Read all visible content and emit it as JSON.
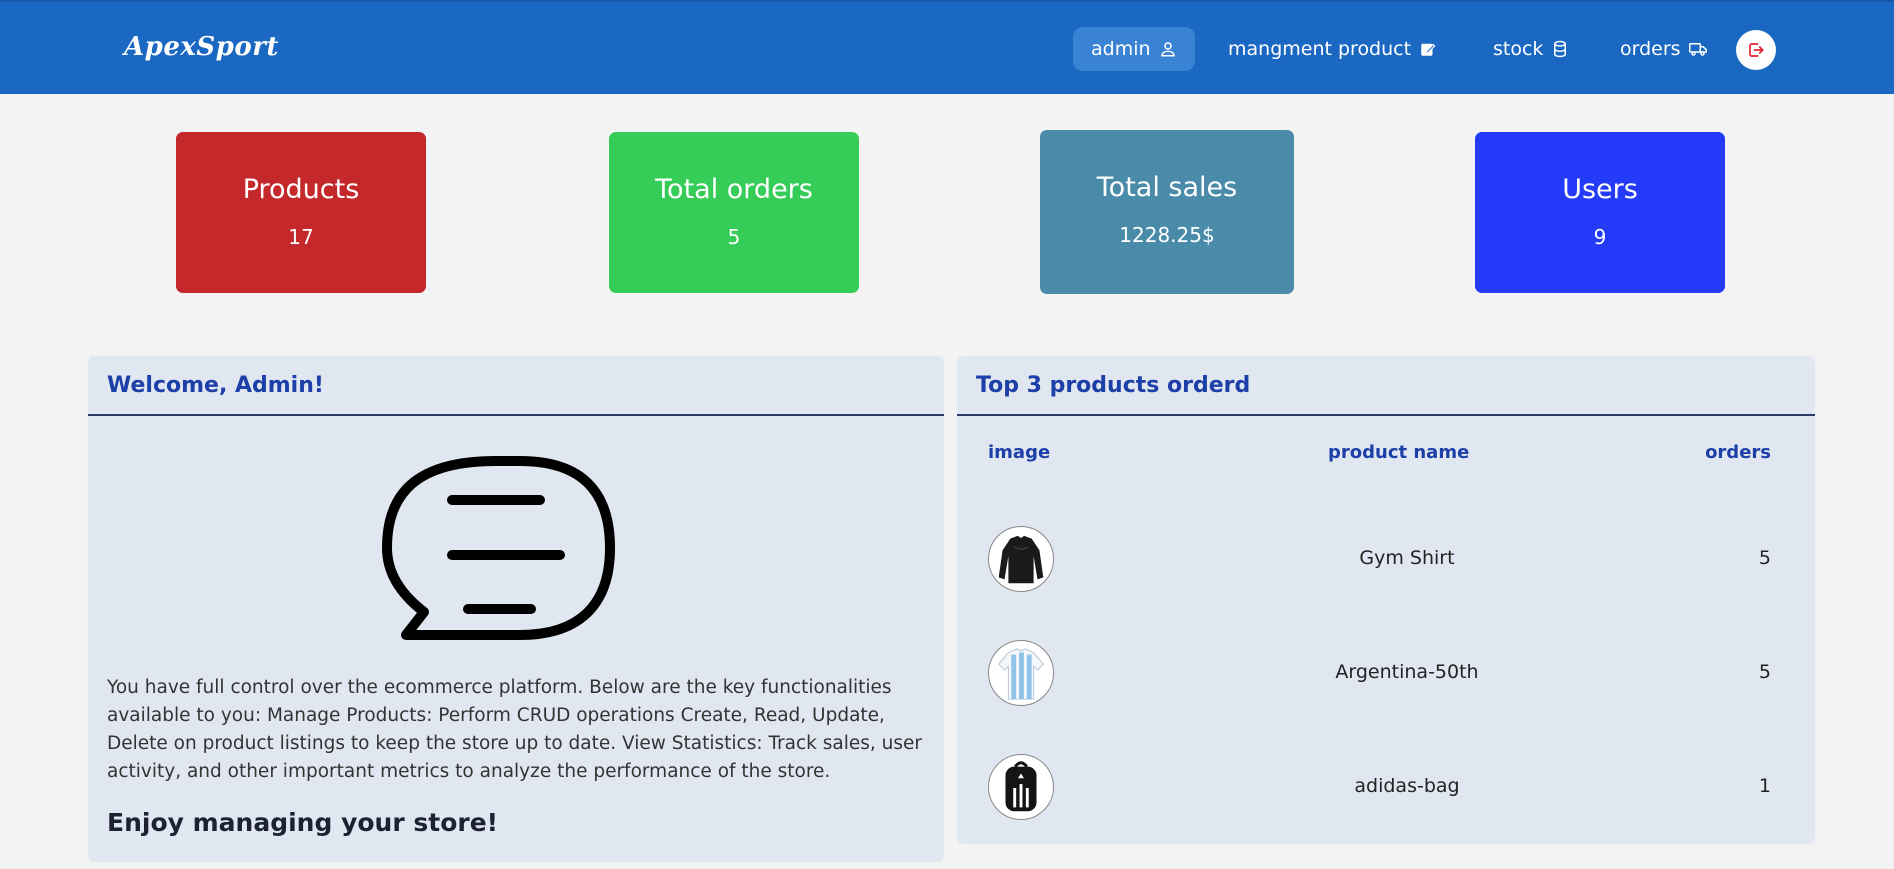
{
  "nav": {
    "brand": "ApexSport",
    "items": [
      {
        "label": "admin",
        "icon": "user-icon",
        "active": true
      },
      {
        "label": "mangment product",
        "icon": "edit-icon"
      },
      {
        "label": "stock",
        "icon": "database-icon"
      },
      {
        "label": "orders",
        "icon": "truck-icon"
      }
    ],
    "logout_icon": "logout-icon"
  },
  "stats": [
    {
      "title": "Products",
      "value": "17",
      "color": "#c4282b"
    },
    {
      "title": "Total orders",
      "value": "5",
      "color": "#35cd58"
    },
    {
      "title": "Total sales",
      "value": "1228.25$",
      "color": "#4a8baa"
    },
    {
      "title": "Users",
      "value": "9",
      "color": "#243bfa"
    }
  ],
  "welcome": {
    "title": "Welcome, Admin!",
    "icon": "chat-bubble-icon",
    "text": "You have full control over the ecommerce platform. Below are the key functionalities available to you: Manage Products: Perform CRUD operations Create, Read, Update, Delete on product listings to keep the store up to date. View Statistics: Track sales, user activity, and other important metrics to analyze the performance of the store.",
    "footer": "Enjoy managing your store!"
  },
  "top_products": {
    "title": "Top 3 products orderd",
    "columns": [
      "image",
      "product name",
      "orders"
    ],
    "rows": [
      {
        "name": "Gym Shirt",
        "orders": "5",
        "image": "black-long-sleeve-shirt"
      },
      {
        "name": "Argentina-50th",
        "orders": "5",
        "image": "argentina-jersey"
      },
      {
        "name": "adidas-bag",
        "orders": "1",
        "image": "black-backpack"
      }
    ]
  },
  "colors": {
    "navbar": "#1b68c3",
    "accent_text": "#1d3fa8",
    "panel_bg": "#e1e7f0",
    "page_bg": "#f3f3f3"
  }
}
